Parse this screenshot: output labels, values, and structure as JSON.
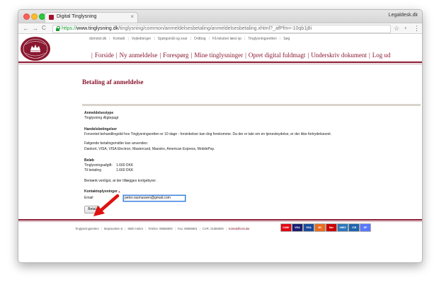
{
  "browser": {
    "tab_title": "Digital Tinglysning",
    "tab_close": "×",
    "profile_name": "Legaldesk.dk",
    "url_https": "https://",
    "url_host": "www.tinglysning.dk",
    "url_path": "/tinglysning/common/anmeldelsesbetaling/anmeldelsesbetaling.xhtml?_afPfm=-10qb1j8i",
    "back_icon": "←",
    "forward_icon": "→",
    "reload_icon": "C",
    "star_icon": "☆",
    "extension_icon": "◐",
    "menu_icon": "⋮"
  },
  "top_nav": [
    "domstol.dk",
    "Kontakt",
    "Vejledninger",
    "Spørgsmål og svar",
    "Ordbog",
    "Få teksten læst op",
    "Tinglysningsretten",
    "Søg"
  ],
  "main_nav": [
    "Forside",
    "Ny anmeldelse",
    "Forespørg",
    "Mine tinglysninger",
    "Opret digital fuldmagt",
    "Underskriv dokument",
    "Log ud"
  ],
  "page": {
    "title": "Betaling af anmeldelse",
    "anmeldelsestype_label": "Anmeldelsestype",
    "anmeldelsestype_value": "Tinglysning Ægtepagt",
    "handelsbetingelser_label": "Handelsbetingelser",
    "handelsbetingelser_text": "Forventet behandlingstid hos Tinglysningsretten er 10 dage - forsinkelser kan dog forekomme. Da der er tale om en tjenesteydelse, er der ikke fortrydelsesret.",
    "betalingsmidler_intro": "Følgende betalingsmidler kan anvendes:",
    "betalingsmidler_list": "Dankort, VISA, VISA Electron, Mastercard, Maestro, American Express, MobilePay.",
    "belob_label": "Beløb",
    "tinglysningsafgift_label": "Tinglysningsafgift:",
    "tinglysningsafgift_value": "1.660 DKK",
    "til_betaling_label": "Til betaling",
    "til_betaling_value": "1.660 DKK",
    "note": "Bemærk venligst, at der tillægges kortgebyrer.",
    "kontakt_label": "Kontaktoplysninger",
    "email_label": "Email",
    "email_required": "*",
    "email_value": "peter.rasmussen@gmail.com",
    "betal_button": "Betal"
  },
  "footer": {
    "items": [
      "Tinglysningsretten",
      "Majsmarken 5",
      "9500 Hobro",
      "Telefon: 99685800",
      "Fax: 99685801",
      "CVR: 21659509"
    ],
    "kontakt": "Kontaktformular"
  },
  "payment_cards": [
    {
      "name": "dankort-icon",
      "label": "DANK",
      "color": "#e30613"
    },
    {
      "name": "visa-icon",
      "label": "VISA",
      "color": "#1a1f71"
    },
    {
      "name": "visa-electron-icon",
      "label": "VISA",
      "color": "#1a4b9c"
    },
    {
      "name": "mastercard-icon",
      "label": "MC",
      "color": "#eb6d1e"
    },
    {
      "name": "maestro-icon",
      "label": "Mae",
      "color": "#cc0000"
    },
    {
      "name": "amex-icon",
      "label": "AMEX",
      "color": "#2e77bb"
    },
    {
      "name": "jcb-icon",
      "label": "JCB",
      "color": "#1d64b0"
    },
    {
      "name": "mobilepay-icon",
      "label": "MP",
      "color": "#5a78ff"
    }
  ],
  "colors": {
    "brand": "#8a1830",
    "https_green": "#1a9c37"
  }
}
